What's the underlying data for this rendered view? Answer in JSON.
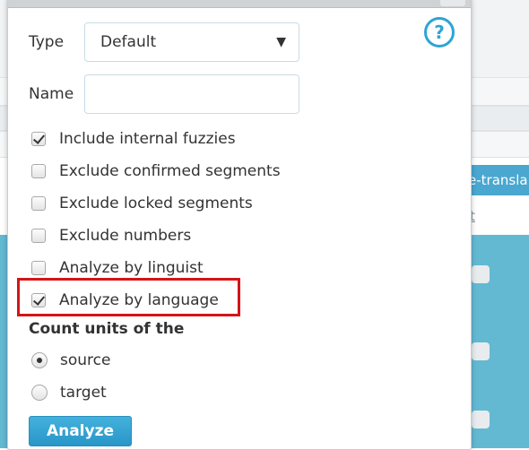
{
  "background": {
    "button_label": "e-transla",
    "link_text": "t"
  },
  "dialog": {
    "help_icon_glyph": "?",
    "type_label": "Type",
    "type_select": {
      "value": "Default",
      "arrow": "▼"
    },
    "name_label": "Name",
    "name_input": {
      "value": "",
      "placeholder": ""
    },
    "options": [
      {
        "label": "Include internal fuzzies",
        "checked": true
      },
      {
        "label": "Exclude confirmed segments",
        "checked": false
      },
      {
        "label": "Exclude locked segments",
        "checked": false
      },
      {
        "label": "Exclude numbers",
        "checked": false
      },
      {
        "label": "Analyze by linguist",
        "checked": false
      },
      {
        "label": "Analyze by language",
        "checked": true,
        "highlighted": true
      }
    ],
    "count_units_title": "Count units of the",
    "count_units": [
      {
        "label": "source",
        "selected": true
      },
      {
        "label": "target",
        "selected": false
      }
    ],
    "analyze_button_label": "Analyze"
  },
  "colors": {
    "accent": "#2ea4d6",
    "highlight_border": "#d41418",
    "background_teal": "#63b9d2"
  }
}
